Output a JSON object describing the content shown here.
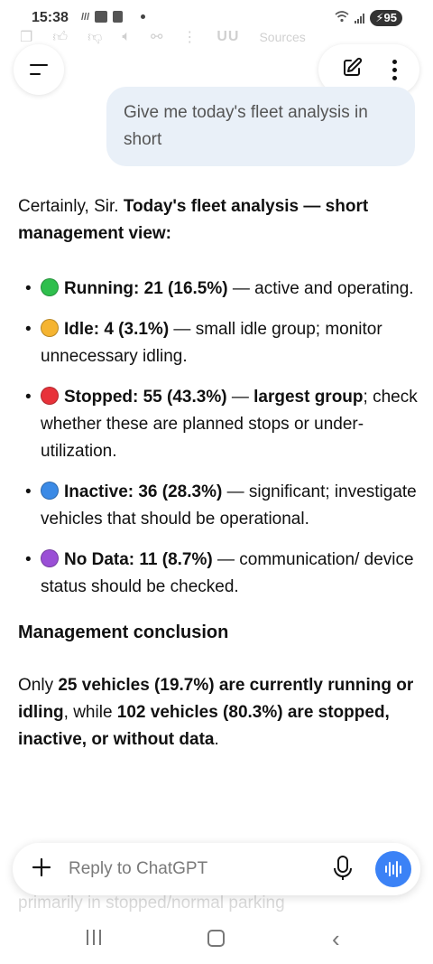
{
  "status_bar": {
    "time": "15:38",
    "battery": "95"
  },
  "ghost_toolbar": {
    "brand": "UU",
    "sources_label": "Sources"
  },
  "conversation": {
    "user_message": "Give me today's fleet analysis in short",
    "assistant": {
      "intro_plain": "Certainly, Sir. ",
      "intro_bold": "Today's fleet analysis — short management view:",
      "bullets": [
        {
          "color": "#2fbf4d",
          "label": "Running: 21 (16.5%)",
          "text_before": " — active and operating.",
          "text_bold": "",
          "text_after": ""
        },
        {
          "color": "#f5b431",
          "label": "Idle: 4 (3.1%)",
          "text_before": " — small idle group; monitor unnecessary idling.",
          "text_bold": "",
          "text_after": ""
        },
        {
          "color": "#e8323a",
          "label": "Stopped: 55 (43.3%)",
          "text_before": " — ",
          "text_bold": "largest group",
          "text_after": "; check whether these are planned stops or under-utilization."
        },
        {
          "color": "#3b8ae6",
          "label": "Inactive: 36 (28.3%)",
          "text_before": " — significant; investigate vehicles that should be operational.",
          "text_bold": "",
          "text_after": ""
        },
        {
          "color": "#9a4fd6",
          "label": "No Data: 11 (8.7%)",
          "text_before": " — communication/ device status should be checked.",
          "text_bold": "",
          "text_after": ""
        }
      ],
      "conclusion_heading": "Management conclusion",
      "conclusion": {
        "p1": "Only ",
        "b1": "25 vehicles (19.7%) are currently running or idling",
        "p2": ", while ",
        "b2": "102 vehicles (80.3%) are stopped, inactive, or without data",
        "p3": "."
      },
      "faded_text": "primarily in stopped/normal parking"
    }
  },
  "composer": {
    "placeholder": "Reply to ChatGPT"
  }
}
